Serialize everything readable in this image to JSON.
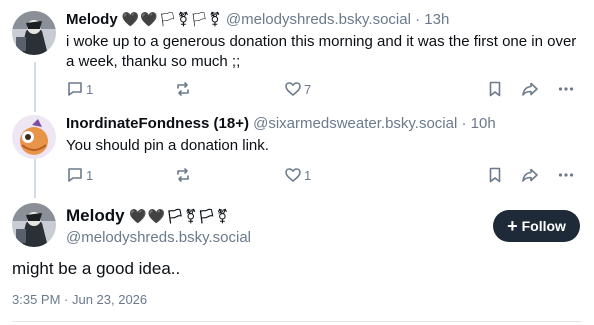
{
  "posts": [
    {
      "name": "Melody",
      "emoji": "🖤🖤🏳⚧🏳⚧",
      "handle": "@melodyshreds.bsky.social",
      "separator": "·",
      "time": "13h",
      "text": "i woke up to a generous donation this morning and it was the first one in over a week, thanku so much ;;",
      "reply_count": "1",
      "like_count": "7"
    },
    {
      "name": "InordinateFondness (18+)",
      "handle": "@sixarmedsweater.bsky.social",
      "separator": "·",
      "time": "10h",
      "text": "You should pin a donation link.",
      "reply_count": "1",
      "like_count": "1"
    }
  ],
  "main_post": {
    "name": "Melody",
    "emoji": "🖤🖤🏳⚧🏳⚧",
    "handle": "@melodyshreds.bsky.social",
    "follow_label": "Follow",
    "text": "might be a good idea..",
    "timestamp": "3:35 PM · Jun 23, 2026"
  },
  "icons": {
    "reply": "reply-icon",
    "repost": "repost-icon",
    "like": "heart-icon",
    "bookmark": "bookmark-icon",
    "share": "share-icon",
    "more": "more-icon"
  },
  "colors": {
    "follow_bg": "#1f2a38",
    "muted": "#6b7a8c",
    "thread_line": "#d4dbe2"
  }
}
